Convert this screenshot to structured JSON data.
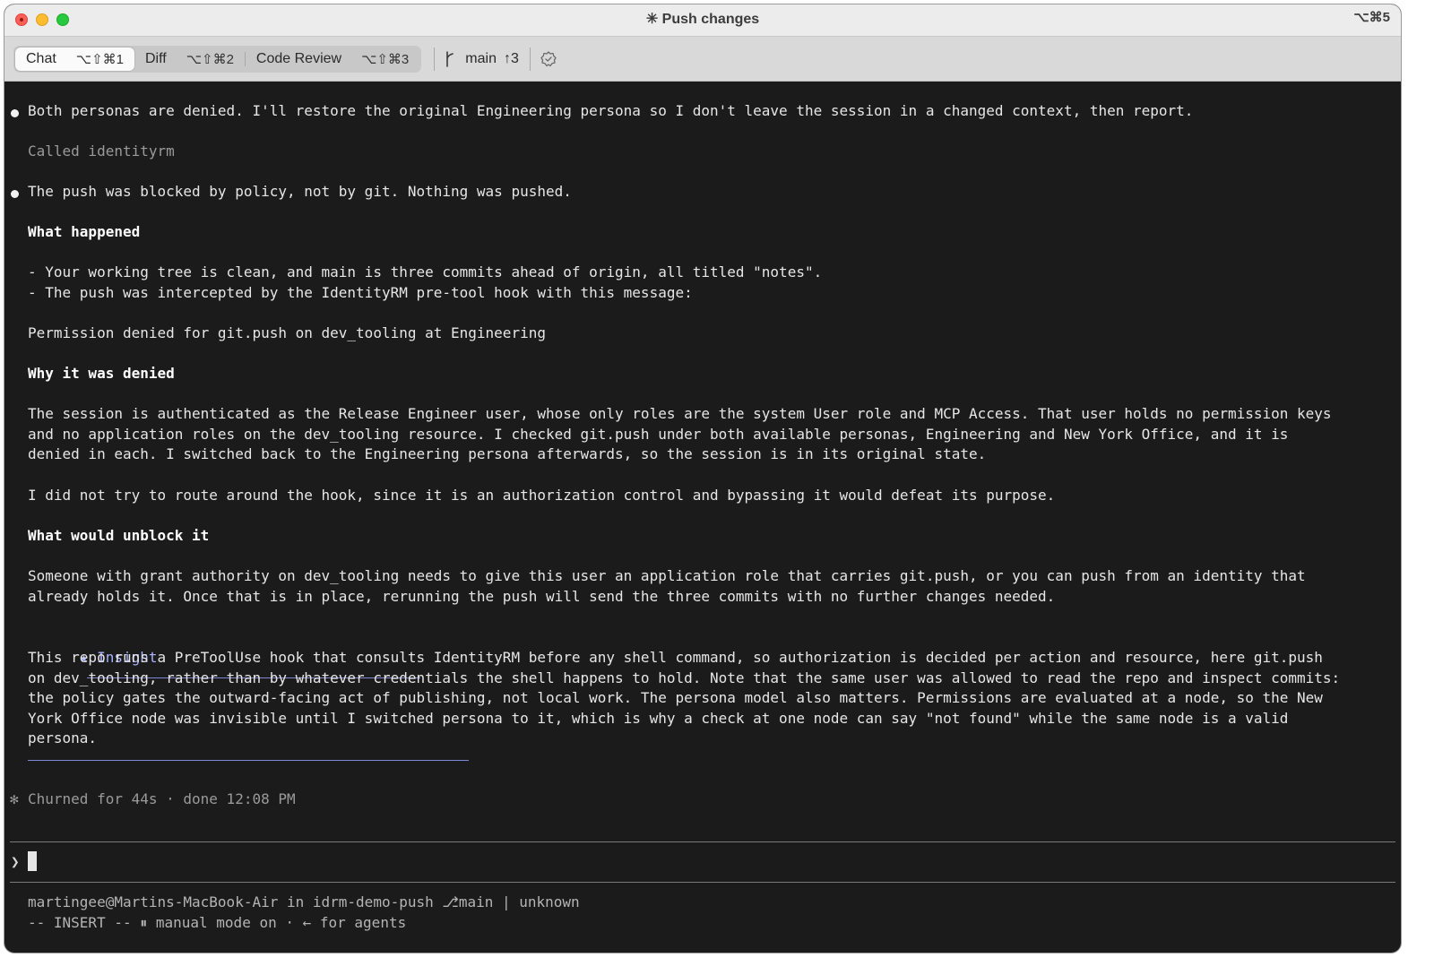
{
  "window": {
    "title": "✳ Push changes",
    "title_shortcut": "⌥⌘5"
  },
  "toolbar": {
    "tabs": [
      {
        "label": "Chat",
        "shortcut": "⌥⇧⌘1",
        "active": true
      },
      {
        "label": "Diff",
        "shortcut": "⌥⇧⌘2",
        "active": false
      },
      {
        "label": "Code Review",
        "shortcut": "⌥⇧⌘3",
        "active": false
      }
    ],
    "branch": "main",
    "ahead": "↑3"
  },
  "transcript": {
    "m1": "Both personas are denied. I'll restore the original Engineering persona so I don't leave the session in a changed context, then report.",
    "tool_call": "Called identityrm",
    "m2": "The push was blocked by policy, not by git. Nothing was pushed.",
    "h_what": "What happened",
    "what_1": "- Your working tree is clean, and main is three commits ahead of origin, all titled \"notes\".",
    "what_2": "- The push was intercepted by the IdentityRM pre-tool hook with this message:",
    "quote": "Permission denied for git.push on dev_tooling at Engineering",
    "h_why": "Why it was denied",
    "why_p1": "The session is authenticated as the Release Engineer user, whose only roles are the system User role and MCP Access. That user holds no permission keys\nand no application roles on the dev_tooling resource. I checked git.push under both available personas, Engineering and New York Office, and it is\ndenied in each. I switched back to the Engineering persona afterwards, so the session is in its original state.",
    "why_p2": "I did not try to route around the hook, since it is an authorization control and bypassing it would defeat its purpose.",
    "h_unblock": "What would unblock it",
    "unblock_p": "Someone with grant authority on dev_tooling needs to give this user an application role that carries git.push, or you can push from an identity that\nalready holds it. Once that is in place, rerunning the push will send the three commits with no further changes needed.",
    "insight_label": "★ Insight",
    "insight_body": "This repo runs a PreToolUse hook that consults IdentityRM before any shell command, so authorization is decided per action and resource, here git.push\non dev_tooling, rather than by whatever credentials the shell happens to hold. Note that the same user was allowed to read the repo and inspect commits:\nthe policy gates the outward-facing act of publishing, not local work. The persona model also matters. Permissions are evaluated at a node, so the New\nYork Office node was invisible until I switched persona to it, which is why a check at one node can say \"not found\" while the same node is a valid\npersona.",
    "churn_icon": "✻",
    "churn": "Churned for 44s · done 12:08 PM"
  },
  "prompt": {
    "caret": "❯"
  },
  "status": {
    "line1": "martingee@Martins-MacBook-Air in idrm-demo-push ⎇main | unknown",
    "line2": "-- INSERT -- ⏸ manual mode on · ← for agents"
  },
  "colors": {
    "background": "#1b1b1b",
    "text": "#e6e6e6",
    "accent_insight": "#a9b4ff"
  }
}
